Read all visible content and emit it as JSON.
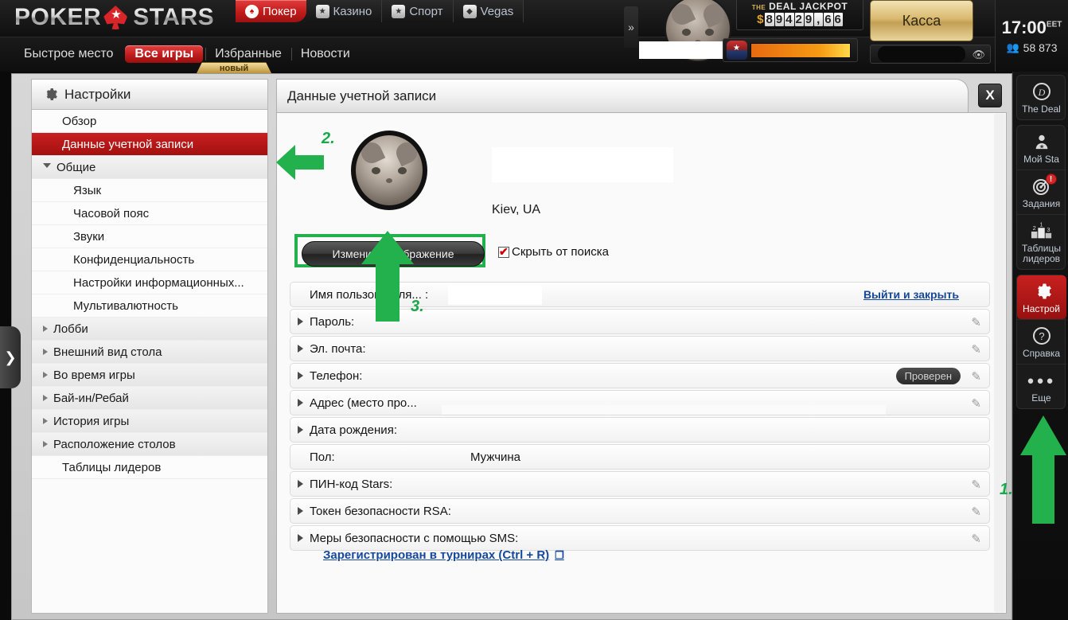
{
  "topbar": {
    "brand": {
      "poker": "POKER",
      "stars": "STARS"
    },
    "product_tabs": [
      {
        "label": "Покер",
        "icon": "spade-icon",
        "active": true
      },
      {
        "label": "Казино",
        "icon": "cards-icon",
        "active": false
      },
      {
        "label": "Спорт",
        "icon": "ball-icon",
        "active": false
      },
      {
        "label": "Vegas",
        "icon": "diamond-icon",
        "active": false
      }
    ],
    "nav_items": [
      {
        "label": "Быстрое место",
        "active": false
      },
      {
        "label": "Все игры",
        "active": true
      },
      {
        "label": "Избранные",
        "active": false
      },
      {
        "label": "Новости",
        "active": false
      }
    ],
    "new_badge": "новый",
    "collapse_icon": "chevron-right-double-icon",
    "jackpot": {
      "the": "THE",
      "title": "DEAL JACKPOT",
      "currency": "$",
      "digits": [
        "8",
        "9",
        "4",
        "2",
        "9",
        ",",
        "6",
        "6"
      ],
      "amount": "$89 429,66"
    },
    "cashier_label": "Касса",
    "clock": {
      "time": "17:00",
      "zone": "EET"
    },
    "players_online": "58 873",
    "eye_icon": "eye-icon"
  },
  "edge_handle": {
    "icon": "chevron-right-icon"
  },
  "sidebar": {
    "header": {
      "title": "Настройки",
      "icon": "gear-icon"
    },
    "items": [
      {
        "label": "Обзор",
        "type": "plain"
      },
      {
        "label": "Данные учетной записи",
        "type": "plain",
        "active": true
      },
      {
        "label": "Общие",
        "type": "group",
        "expanded": true
      },
      {
        "label": "Язык",
        "type": "child"
      },
      {
        "label": "Часовой пояс",
        "type": "child"
      },
      {
        "label": "Звуки",
        "type": "child"
      },
      {
        "label": "Конфиденциальность",
        "type": "child"
      },
      {
        "label": "Настройки информационных...",
        "type": "child"
      },
      {
        "label": "Мультивалютность",
        "type": "child"
      },
      {
        "label": "Лобби",
        "type": "group"
      },
      {
        "label": "Внешний вид стола",
        "type": "group"
      },
      {
        "label": "Во время игры",
        "type": "group"
      },
      {
        "label": "Бай-ин/Ребай",
        "type": "group"
      },
      {
        "label": "История игры",
        "type": "group"
      },
      {
        "label": "Расположение столов",
        "type": "group"
      },
      {
        "label": "Таблицы лидеров",
        "type": "plain"
      }
    ]
  },
  "panel": {
    "title": "Данные учетной записи",
    "close_label": "X",
    "profile": {
      "location": "Kiev, UA",
      "change_image_label": "Изменить изображение",
      "hide_from_search_label": "Скрыть от поиска",
      "hide_from_search_checked": true
    },
    "rows": [
      {
        "label": "Имя пользователя... :",
        "arrow": false,
        "link": "Выйти и закрыть",
        "redact": "a"
      },
      {
        "label": "Пароль:",
        "arrow": true,
        "pencil": true
      },
      {
        "label": "Эл. почта:",
        "arrow": true,
        "pencil": true
      },
      {
        "label": "Телефон:",
        "arrow": true,
        "pencil": true,
        "badge": "Проверен"
      },
      {
        "label": "Адрес (место про...",
        "arrow": true,
        "pencil": true,
        "redact": "b"
      },
      {
        "label": "Дата рождения:",
        "arrow": true
      },
      {
        "label": "Пол:",
        "arrow": false,
        "value": "Мужчина"
      },
      {
        "label": "ПИН-код Stars:",
        "arrow": true,
        "pencil": true
      },
      {
        "label": "Токен безопасности RSA:",
        "arrow": true,
        "pencil": true
      },
      {
        "label": "Меры безопасности с помощью SMS:",
        "arrow": true,
        "pencil": true
      }
    ],
    "tournament_link": "Зарегистрирован в турнирах (Ctrl + R)",
    "external_icon": "external-window-icon"
  },
  "rail": {
    "items": [
      {
        "label": "The Deal",
        "icon": "deal-d-icon",
        "active": false
      },
      {
        "label": "Мой Sta",
        "icon": "user-star-icon",
        "active": false
      },
      {
        "label": "Задания",
        "icon": "target-icon",
        "active": false,
        "badge": "!"
      },
      {
        "label": "Таблицы лидеров",
        "icon": "podium-icon",
        "active": false
      },
      {
        "label": "Настрой",
        "icon": "gear-icon",
        "active": true
      },
      {
        "label": "Справка",
        "icon": "help-icon",
        "active": false
      },
      {
        "label": "Еще",
        "icon": "ellipsis-icon",
        "active": false
      }
    ]
  },
  "annotations": {
    "marker_1": "1.",
    "marker_2": "2.",
    "marker_3": "3.",
    "color": "#1aa84a"
  }
}
